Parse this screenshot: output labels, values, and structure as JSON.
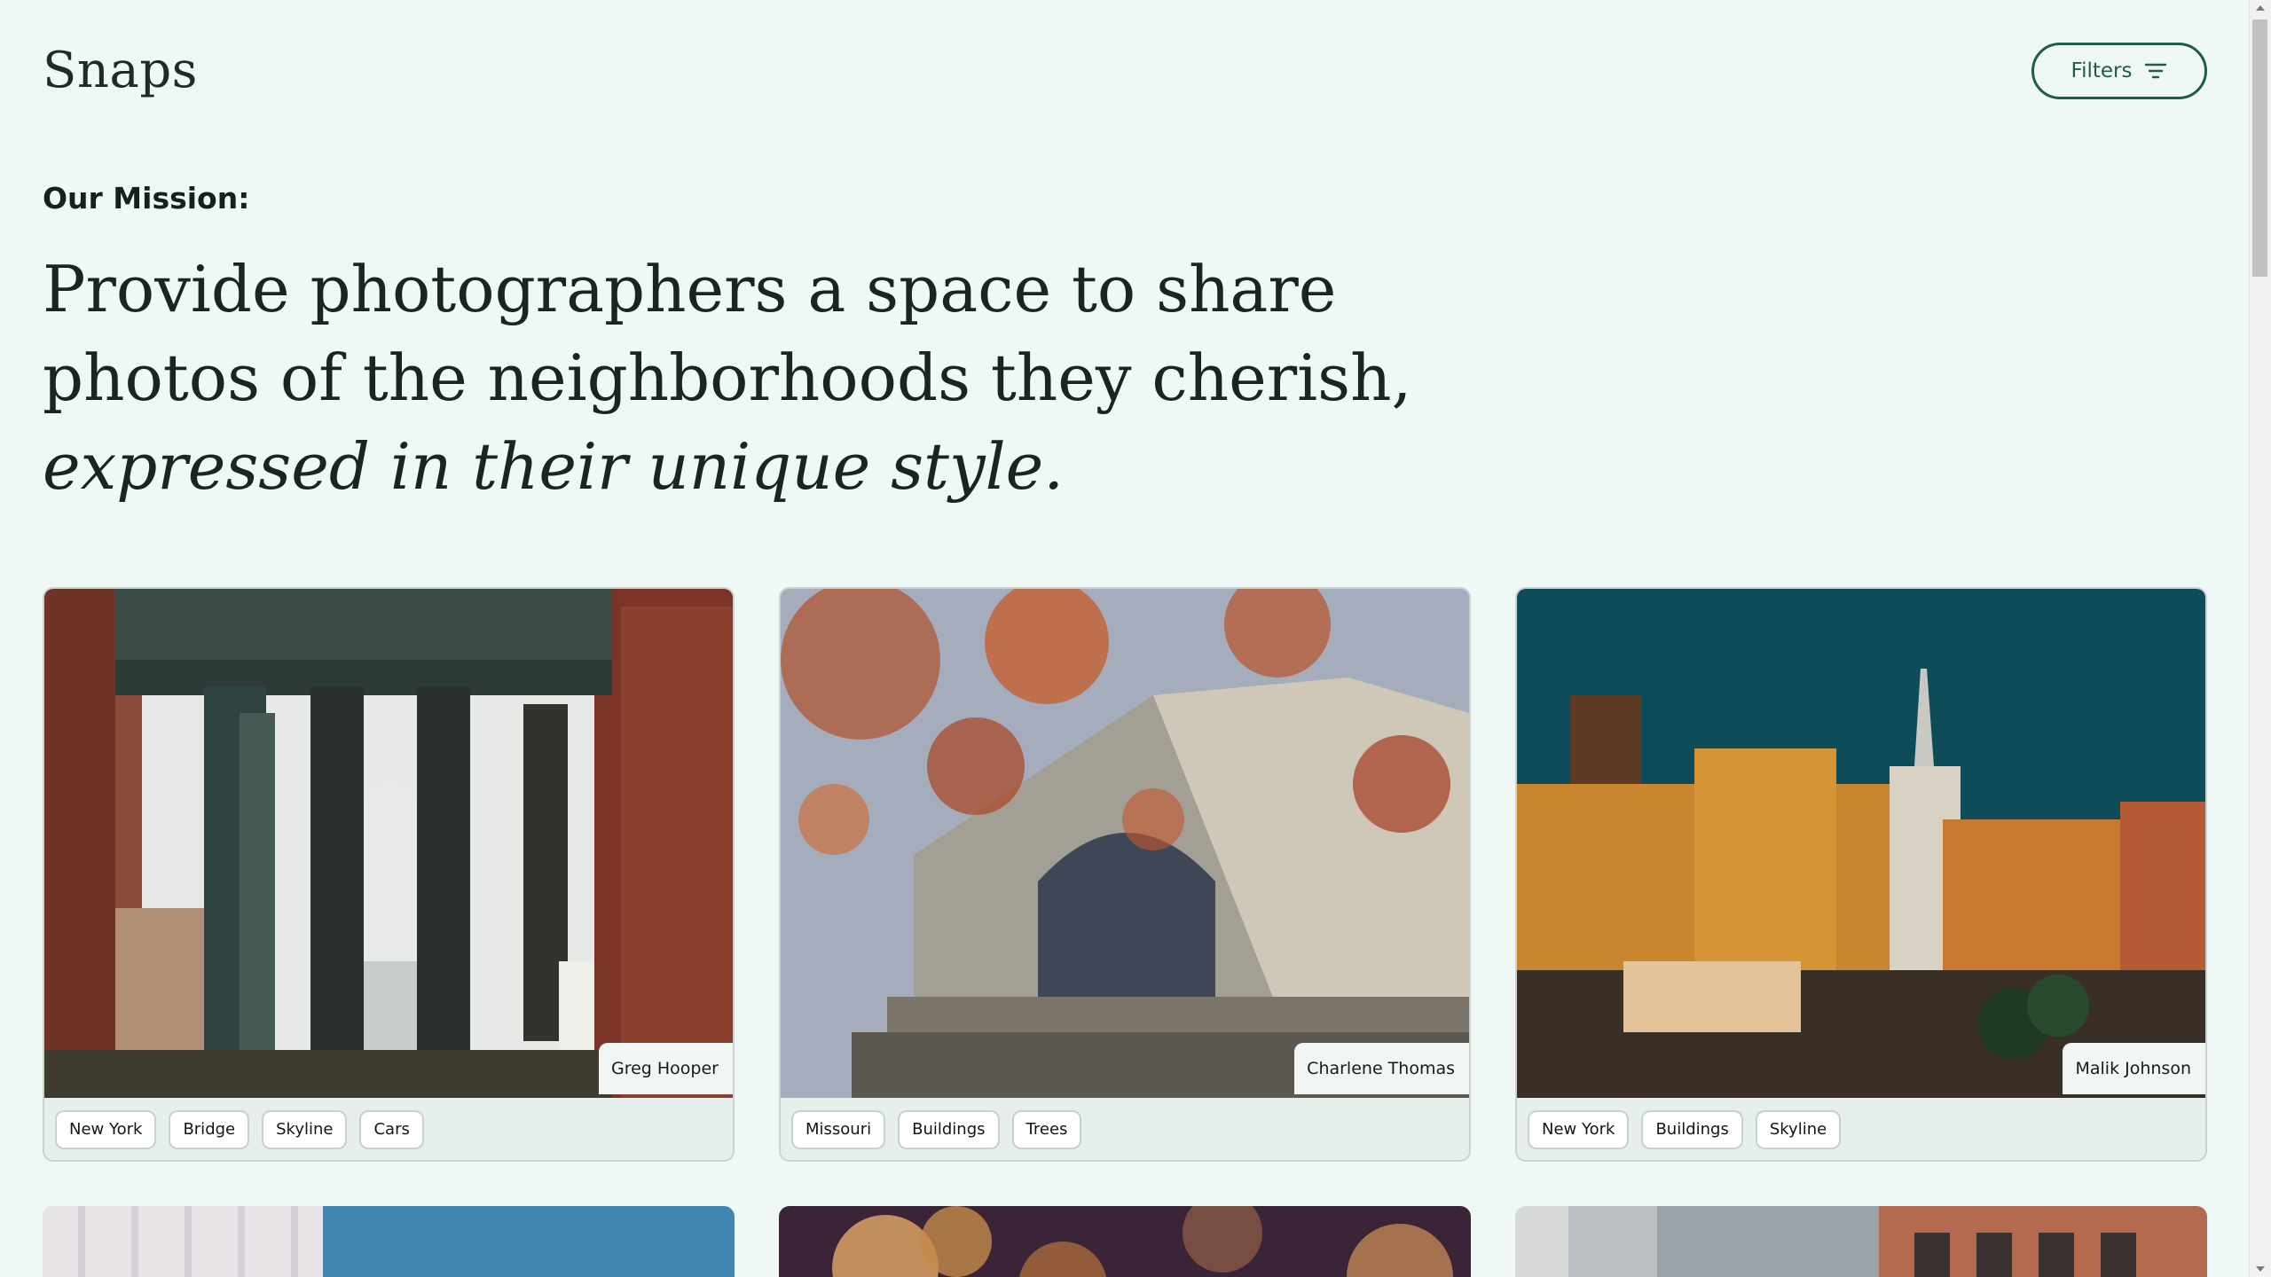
{
  "header": {
    "brand": "Snaps",
    "filters_label": "Filters"
  },
  "mission": {
    "label": "Our Mission:",
    "line1": "Provide photographers a space to share",
    "line2": "photos of the neighborhoods they cherish,",
    "line3": "expressed in their unique style."
  },
  "cards": [
    {
      "author": "Greg Hooper",
      "tags": [
        "New York",
        "Bridge",
        "Skyline",
        "Cars"
      ]
    },
    {
      "author": "Charlene Thomas",
      "tags": [
        "Missouri",
        "Buildings",
        "Trees"
      ]
    },
    {
      "author": "Malik Johnson",
      "tags": [
        "New York",
        "Buildings",
        "Skyline"
      ]
    }
  ],
  "colors": {
    "background": "#eff8f4",
    "accent": "#1f5c4a"
  }
}
